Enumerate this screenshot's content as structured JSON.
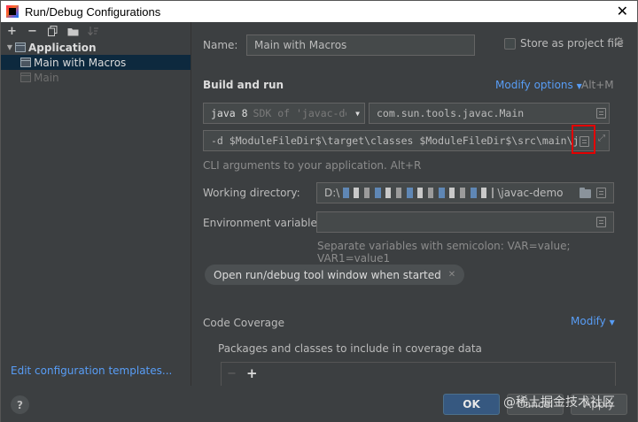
{
  "window": {
    "title": "Run/Debug Configurations",
    "close_glyph": "✕"
  },
  "toolbar": {
    "buttons": [
      {
        "name": "add-icon",
        "glyph": "+"
      },
      {
        "name": "remove-icon",
        "glyph": "−"
      },
      {
        "name": "copy-icon",
        "glyph": "⧉"
      },
      {
        "name": "move-to-folder-icon",
        "glyph": "▤"
      },
      {
        "name": "sort-icon",
        "glyph": "↓≡"
      }
    ]
  },
  "tree": {
    "parent": {
      "label": "Application",
      "expanded_glyph": "▼"
    },
    "children": [
      {
        "label": "Main with Macros",
        "selected": true
      },
      {
        "label": "Main",
        "selected": false
      }
    ]
  },
  "edit_templates_link": "Edit configuration templates...",
  "form": {
    "name_label": "Name:",
    "name_value": "Main with Macros",
    "store_label": "Store as project file",
    "build_run_heading": "Build and run",
    "modify_options": "Modify options",
    "modify_options_shortcut": "Alt+M",
    "jdk_value": "java 8",
    "jdk_detail": "SDK of 'javac-de",
    "main_class": "com.sun.tools.javac.Main",
    "program_args": "-d $ModuleFileDir$\\target\\classes $ModuleFileDir$\\src\\main\\j",
    "cli_hint": "CLI arguments to your application. Alt+R",
    "working_dir_label": "Working directory:",
    "working_dir_prefix": "D:\\",
    "working_dir_suffix": "\\javac-demo",
    "env_label": "Environment variables:",
    "env_hint": "Separate variables with semicolon: VAR=value; VAR1=value1",
    "chip_label": "Open run/debug tool window when started",
    "chip_close": "✕",
    "coverage_heading": "Code Coverage",
    "coverage_modify": "Modify",
    "coverage_include": "Packages and classes to include in coverage data",
    "coverage_minus": "−",
    "coverage_plus": "+"
  },
  "buttons": {
    "help": "?",
    "ok": "OK",
    "cancel": "Cancel",
    "apply": "Apply"
  },
  "watermark": "@稀土掘金技术社区",
  "colors": {
    "accent": "#589df6",
    "highlight": "#e30000",
    "selection": "#0d293e"
  }
}
